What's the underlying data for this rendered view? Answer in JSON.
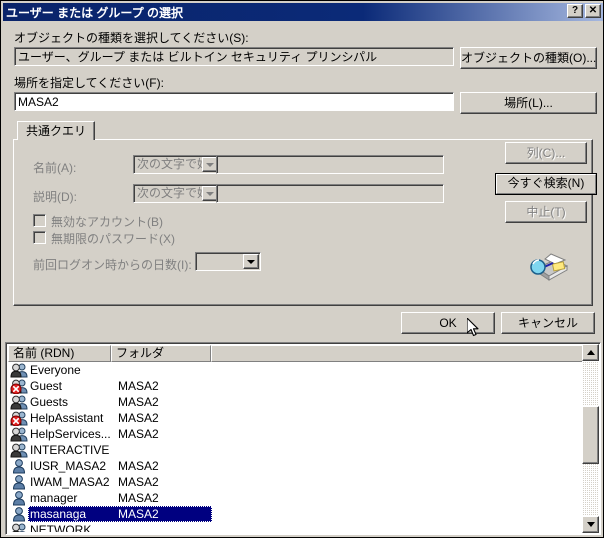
{
  "window": {
    "title": "ユーザー または グループ の選択",
    "help_button": "?",
    "close_button": "✕"
  },
  "object_types": {
    "label": "オブジェクトの種類を選択してください(S):",
    "value": "ユーザー、グループ または ビルトイン セキュリティ プリンシパル",
    "button": "オブジェクトの種類(O)..."
  },
  "location": {
    "label": "場所を指定してください(F):",
    "value": "MASA2",
    "button": "場所(L)..."
  },
  "query_tab": {
    "tab_label": "共通クエリ",
    "name_label": "名前(A):",
    "name_condition": "次の文字で始",
    "name_value": "",
    "desc_label": "説明(D):",
    "desc_condition": "次の文字で始",
    "desc_value": "",
    "disabled_accounts_label": "無効なアカウント(B)",
    "nonexpiring_password_label": "無期限のパスワード(X)",
    "days_since_logon_label": "前回ログオン時からの日数(I):",
    "days_since_logon_value": "",
    "columns_button": "列(C)...",
    "find_now_button": "今すぐ検索(N)",
    "stop_button": "中止(T)"
  },
  "footer": {
    "ok_button": "OK",
    "cancel_button": "キャンセル"
  },
  "results": {
    "columns": [
      "名前 (RDN)",
      "フォルダ",
      ""
    ],
    "rows": [
      {
        "icon": "group-icon",
        "name": "Everyone",
        "folder": "",
        "selected": false
      },
      {
        "icon": "group-disabled-icon",
        "name": "Guest",
        "folder": "MASA2",
        "selected": false
      },
      {
        "icon": "group-icon",
        "name": "Guests",
        "folder": "MASA2",
        "selected": false
      },
      {
        "icon": "group-disabled-icon",
        "name": "HelpAssistant",
        "folder": "MASA2",
        "selected": false
      },
      {
        "icon": "group-icon",
        "name": "HelpServices...",
        "folder": "MASA2",
        "selected": false
      },
      {
        "icon": "group-icon",
        "name": "INTERACTIVE",
        "folder": "",
        "selected": false
      },
      {
        "icon": "user-icon",
        "name": "IUSR_MASA2",
        "folder": "MASA2",
        "selected": false
      },
      {
        "icon": "user-icon",
        "name": "IWAM_MASA2",
        "folder": "MASA2",
        "selected": false
      },
      {
        "icon": "user-icon",
        "name": "manager",
        "folder": "MASA2",
        "selected": false
      },
      {
        "icon": "user-icon",
        "name": "masanaga",
        "folder": "MASA2",
        "selected": true
      },
      {
        "icon": "group-icon",
        "name": "NETWORK",
        "folder": "",
        "selected": false
      }
    ]
  },
  "colors": {
    "titlebar_start": "#0a246a",
    "titlebar_end": "#a6b8e0",
    "face": "#d4d0c8",
    "selection": "#000080",
    "disabled_text": "#808080"
  }
}
